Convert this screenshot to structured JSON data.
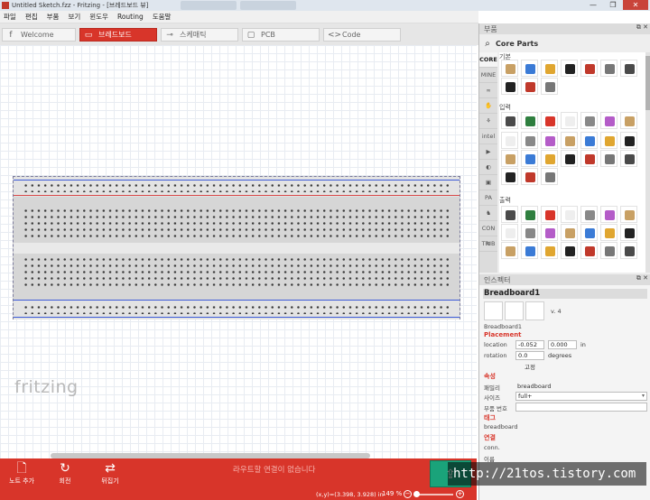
{
  "window": {
    "title": "Untitled Sketch.fzz - Fritzing - [브레드보드 뷰]",
    "controls": [
      "—",
      "❐",
      "✕"
    ]
  },
  "menu": [
    "파일",
    "편집",
    "부품",
    "보기",
    "윈도우",
    "Routing",
    "도움말"
  ],
  "tabs": [
    {
      "label": "Welcome",
      "icon": "f",
      "active": false
    },
    {
      "label": "브레드보드",
      "icon": "▭",
      "active": true
    },
    {
      "label": "스케매틱",
      "icon": "⊸",
      "active": false
    },
    {
      "label": "PCB",
      "icon": "▢",
      "active": false
    },
    {
      "label": "Code",
      "icon": "<>",
      "active": false
    }
  ],
  "canvas": {
    "logo": "fritzing",
    "rail_colors": {
      "top": "#d84a4a",
      "bottom": "#3d5bd8"
    }
  },
  "toolbar": {
    "add_note": "노트 추가",
    "rotate": "회전",
    "flip": "뒤집기",
    "routing_status": "라우트할 연결이 없습니다"
  },
  "statusbar": {
    "coords": "(x,y)=(3.398, 3.928) in",
    "zoom": "149 %"
  },
  "parts_dock": {
    "header": "부품",
    "bin_title": "Core Parts",
    "bin_tabs": [
      "CORE",
      "MINE",
      "∞",
      "✋",
      "⚘",
      "intel",
      "▶",
      "◐",
      "▣",
      "PA",
      "♞",
      "CON TRIB",
      "≋"
    ],
    "sections": [
      "기본",
      "입력",
      "출력"
    ]
  },
  "inspector": {
    "header": "인스펙터",
    "title": "Breadboard1",
    "version": "v. 4",
    "caption": "Breadboard1",
    "placement_section": "Placement",
    "location_label": "location",
    "location_x": "-0.052",
    "location_y": "0.000",
    "location_unit": "in",
    "rotation_label": "rotation",
    "rotation_value": "0.0",
    "rotation_unit": "degrees",
    "lock_label": "고정",
    "props_section": "속성",
    "family_label": "패밀리",
    "family_value": "breadboard",
    "size_label": "사이즈",
    "size_value": "full+",
    "part_number_label": "부품 번호",
    "tags_section": "태그",
    "tags_value": "breadboard",
    "connections_section": "연결",
    "conn_label": "conn.",
    "name_label": "이름"
  },
  "watermark": "http://21tos.tistory.com",
  "colors": {
    "accent": "#d8352a",
    "share": "#1aa37a"
  }
}
